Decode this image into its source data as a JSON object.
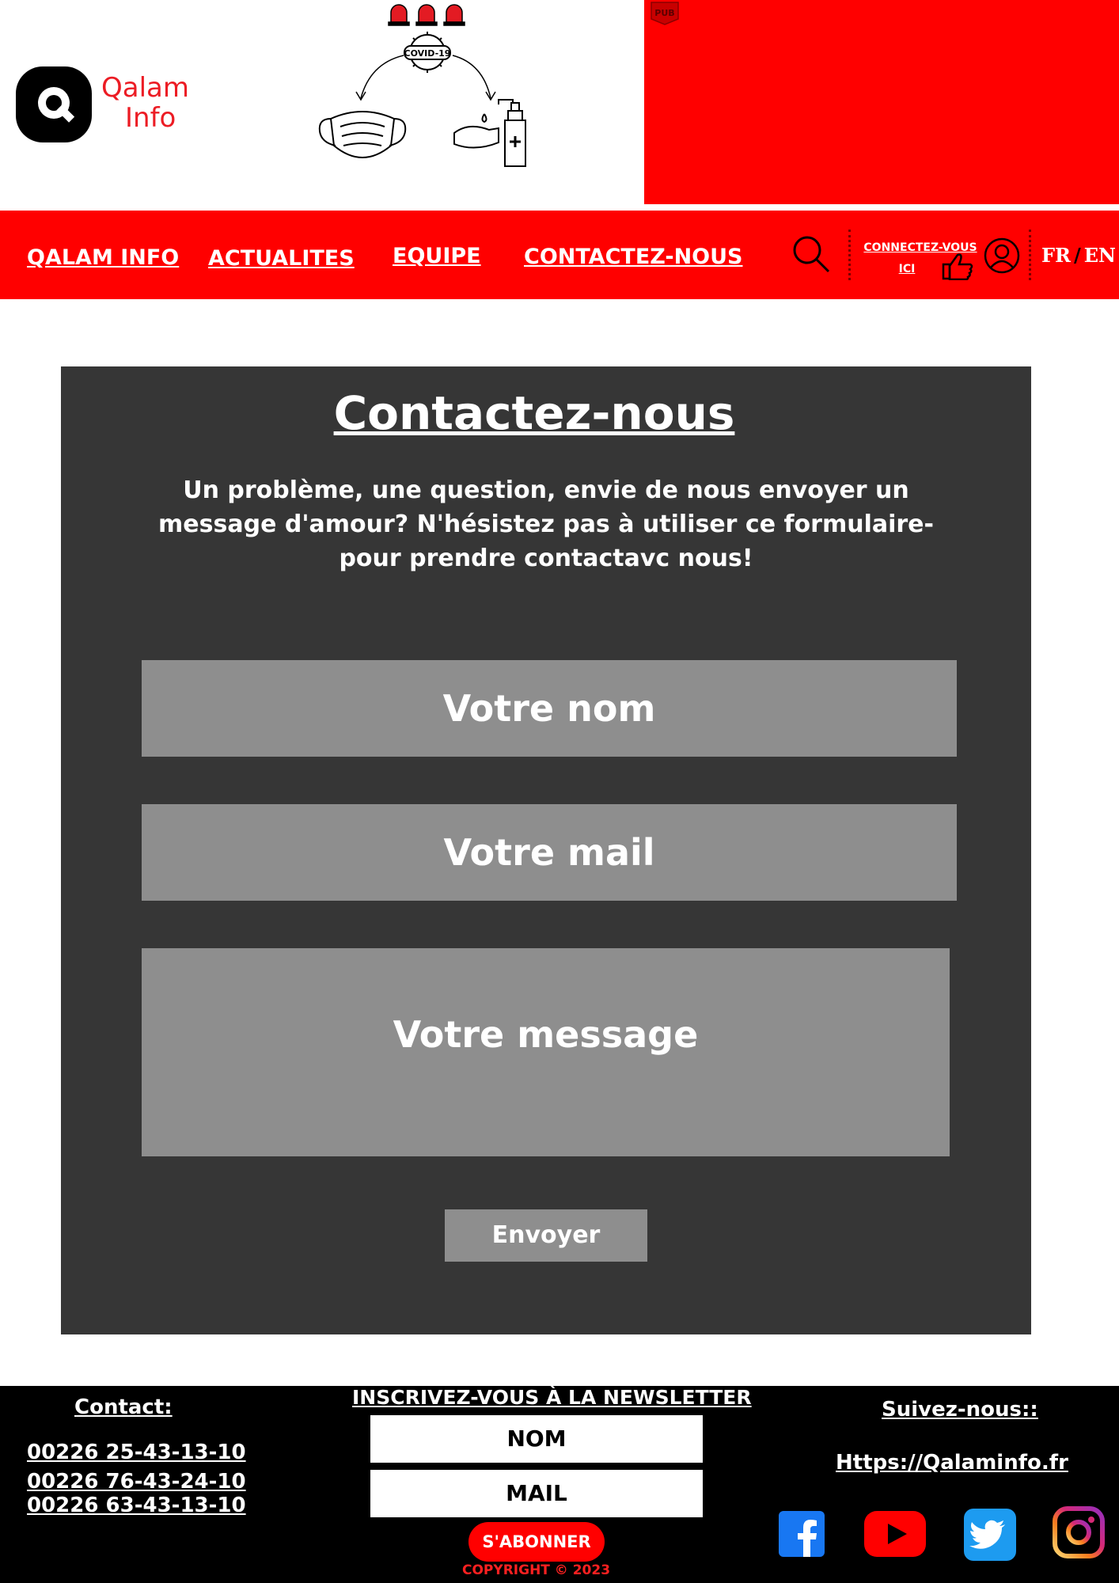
{
  "header": {
    "logo_line1": "Qalam",
    "logo_line2": "Info",
    "covid_badge": "COVID-19",
    "pub_label": "PUB"
  },
  "nav": {
    "items": [
      "QALAM INFO",
      "ACTUALITES",
      "EQUIPE",
      "CONTACTEZ-NOUS"
    ],
    "connect_line1": "CONNECTEZ-VOUS",
    "connect_line2": "ICI",
    "lang_fr": "FR",
    "lang_sep": "/",
    "lang_en": "EN"
  },
  "contact": {
    "title": "Contactez-nous",
    "intro": "Un problème, une question, envie de nous envoyer un message d'amour? N'hésistez pas à utiliser ce formulaire- pour prendre contactavc nous!",
    "name_placeholder": "Votre nom",
    "mail_placeholder": "Votre mail",
    "message_placeholder": "Votre message",
    "send_label": "Envoyer"
  },
  "footer": {
    "contact_label": "Contact:",
    "phones": [
      "00226 25-43-13-10",
      "00226 76-43-24-10",
      "00226 63-43-13-10"
    ],
    "newsletter_title": "INSCRIVEZ-VOUS À LA NEWSLETTER",
    "newsletter_name": "NOM",
    "newsletter_mail": "MAIL",
    "subscribe_label": "S'ABONNER",
    "copyright": "COPYRIGHT © 2023",
    "follow_label": "Suivez-nous::",
    "site_url": "Https://Qalaminfo.fr",
    "social": [
      "facebook-icon",
      "youtube-icon",
      "twitter-icon",
      "instagram-icon"
    ]
  },
  "colors": {
    "brand_red": "#ff0000",
    "logo_red": "#ec1c24",
    "panel_bg": "#363636",
    "field_bg": "#8e8e8e",
    "footer_bg": "#000000"
  }
}
